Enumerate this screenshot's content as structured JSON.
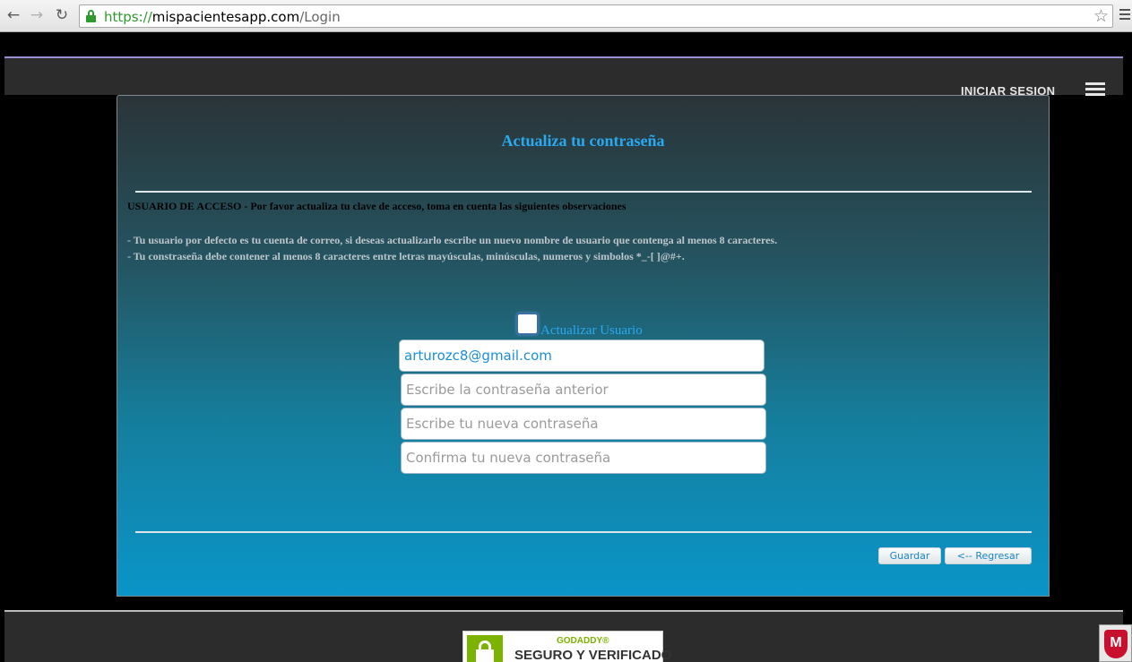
{
  "browser": {
    "url_scheme": "https://",
    "url_host": "mispacientesapp.com",
    "url_path": "/Login"
  },
  "header": {
    "login_link": "INICIAR SESION"
  },
  "panel": {
    "title": "Actualiza tu contraseña",
    "intro": "USUARIO DE ACCESO - Por favor actualiza tu clave de acceso, toma en cuenta las siguientes observaciones",
    "note_1": "- Tu usuario por defecto es tu cuenta de correo, si deseas actualizarlo escribe un nuevo nombre de usuario que contenga al menos 8 caracteres.",
    "note_2": "- Tu constraseña debe contener al menos 8 caracteres entre letras mayúsculas, minúsculas, numeros y simbolos *_-[ ]@#+.",
    "update_user_label": "Actualizar Usuario",
    "update_user_checked": false,
    "username_value": "arturozc8@gmail.com",
    "old_password_placeholder": "Escribe la contraseña anterior",
    "new_password_placeholder": "Escribe tu nueva contraseña",
    "confirm_password_placeholder": "Confirma tu nueva contraseña",
    "save_label": "Guardar",
    "back_label": "<-- Regresar"
  },
  "footer": {
    "seal_top": "GODADDY®",
    "seal_main": "SEGURO Y VERIFICADO",
    "mcafee_letter": "M"
  },
  "colors": {
    "title": "#2aa9f0",
    "panel_bottom": "#0a95c8"
  }
}
